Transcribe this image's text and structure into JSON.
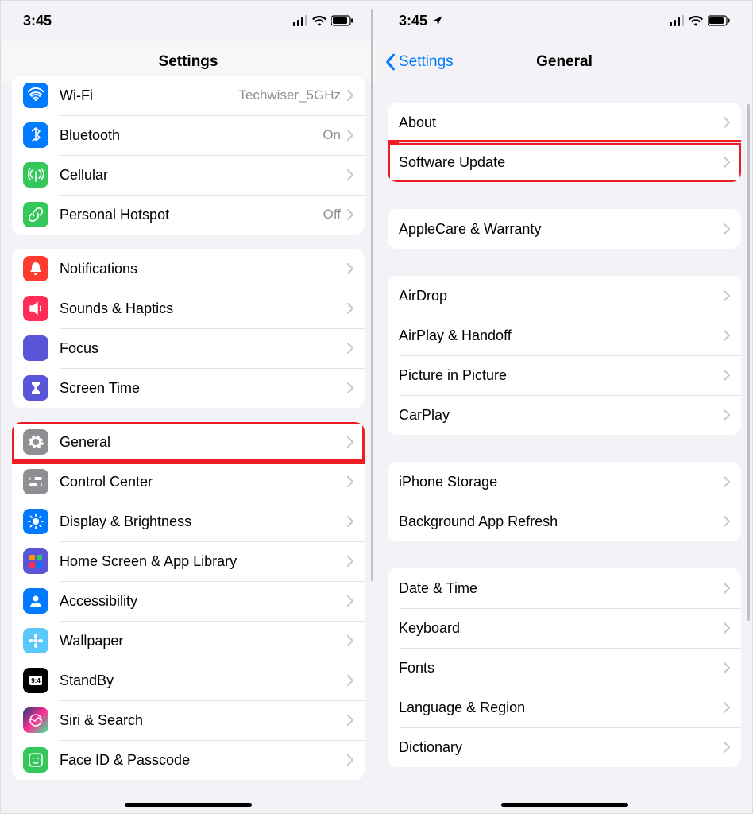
{
  "status": {
    "time": "3:45"
  },
  "left": {
    "title": "Settings",
    "groups": [
      {
        "first": true,
        "rows": [
          {
            "name": "wifi",
            "label": "Wi-Fi",
            "value": "Techwiser_5GHz",
            "iconBg": "bg-blue",
            "icon": "wifi"
          },
          {
            "name": "bluetooth",
            "label": "Bluetooth",
            "value": "On",
            "iconBg": "bg-blue",
            "icon": "bluetooth"
          },
          {
            "name": "cellular",
            "label": "Cellular",
            "iconBg": "bg-green",
            "icon": "antenna"
          },
          {
            "name": "personal-hotspot",
            "label": "Personal Hotspot",
            "value": "Off",
            "iconBg": "bg-green",
            "icon": "link"
          }
        ]
      },
      {
        "rows": [
          {
            "name": "notifications",
            "label": "Notifications",
            "iconBg": "bg-red",
            "icon": "bell"
          },
          {
            "name": "sounds-haptics",
            "label": "Sounds & Haptics",
            "iconBg": "bg-pink",
            "icon": "speaker"
          },
          {
            "name": "focus",
            "label": "Focus",
            "iconBg": "bg-indigo",
            "icon": "moon"
          },
          {
            "name": "screen-time",
            "label": "Screen Time",
            "iconBg": "bg-indigo",
            "icon": "hourglass"
          }
        ]
      },
      {
        "rows": [
          {
            "name": "general",
            "label": "General",
            "iconBg": "bg-gray",
            "icon": "gear",
            "highlight": true
          },
          {
            "name": "control-center",
            "label": "Control Center",
            "iconBg": "bg-gray",
            "icon": "switches"
          },
          {
            "name": "display-brightness",
            "label": "Display & Brightness",
            "iconBg": "bg-blue",
            "icon": "sun"
          },
          {
            "name": "home-screen",
            "label": "Home Screen & App Library",
            "iconBg": "bg-indigo",
            "icon": "grid"
          },
          {
            "name": "accessibility",
            "label": "Accessibility",
            "iconBg": "bg-blue",
            "icon": "person"
          },
          {
            "name": "wallpaper",
            "label": "Wallpaper",
            "iconBg": "bg-lblue",
            "icon": "flower"
          },
          {
            "name": "standby",
            "label": "StandBy",
            "iconBg": "bg-black",
            "icon": "clock"
          },
          {
            "name": "siri-search",
            "label": "Siri & Search",
            "iconBg": "bg-siri",
            "icon": "siri"
          },
          {
            "name": "faceid-passcode",
            "label": "Face ID & Passcode",
            "iconBg": "bg-green",
            "icon": "face"
          }
        ]
      }
    ]
  },
  "right": {
    "back": "Settings",
    "title": "General",
    "hasLocation": true,
    "groups": [
      {
        "first": true,
        "rows": [
          {
            "name": "about",
            "label": "About"
          },
          {
            "name": "software-update",
            "label": "Software Update",
            "highlight": true
          }
        ]
      },
      {
        "rows": [
          {
            "name": "applecare-warranty",
            "label": "AppleCare & Warranty"
          }
        ]
      },
      {
        "rows": [
          {
            "name": "airdrop",
            "label": "AirDrop"
          },
          {
            "name": "airplay-handoff",
            "label": "AirPlay & Handoff"
          },
          {
            "name": "picture-in-picture",
            "label": "Picture in Picture"
          },
          {
            "name": "carplay",
            "label": "CarPlay"
          }
        ]
      },
      {
        "rows": [
          {
            "name": "iphone-storage",
            "label": "iPhone Storage"
          },
          {
            "name": "background-app-refresh",
            "label": "Background App Refresh"
          }
        ]
      },
      {
        "rows": [
          {
            "name": "date-time",
            "label": "Date & Time"
          },
          {
            "name": "keyboard",
            "label": "Keyboard"
          },
          {
            "name": "fonts",
            "label": "Fonts"
          },
          {
            "name": "language-region",
            "label": "Language & Region"
          },
          {
            "name": "dictionary",
            "label": "Dictionary"
          }
        ]
      }
    ]
  }
}
